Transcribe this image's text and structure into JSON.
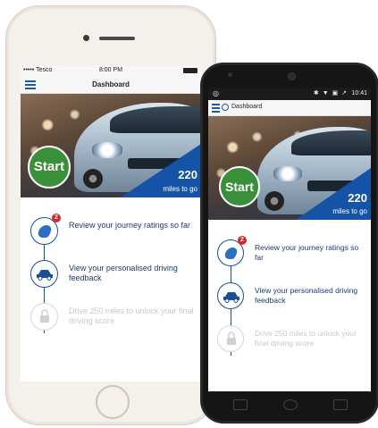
{
  "iphone": {
    "status": {
      "carrier": "••••• Tesco",
      "time": "8:00 PM"
    },
    "header": {
      "title": "Dashboard",
      "menu_icon": "hamburger-menu-icon"
    }
  },
  "android": {
    "status": {
      "time": "10:41",
      "indicators": "✱ ▼ ▣ ↗"
    },
    "header": {
      "title": "Dashboard",
      "menu_icon": "hamburger-menu-icon"
    }
  },
  "dashboard": {
    "start_label": "Start",
    "miles_value": "220",
    "miles_label": "miles to go",
    "steps": [
      {
        "text": "Review your journey ratings so far",
        "badge": "2",
        "icon": "road-icon",
        "enabled": true
      },
      {
        "text": "View your personalised driving feedback",
        "icon": "car-icon",
        "enabled": true
      },
      {
        "text": "Drive 250 miles to unlock your final driving score",
        "icon": "lock-icon",
        "enabled": false
      }
    ]
  },
  "colors": {
    "start_green": "#3a8f3a",
    "brand_blue": "#1553a6",
    "badge_red": "#d9252a",
    "step_text": "#1d3c6c"
  }
}
